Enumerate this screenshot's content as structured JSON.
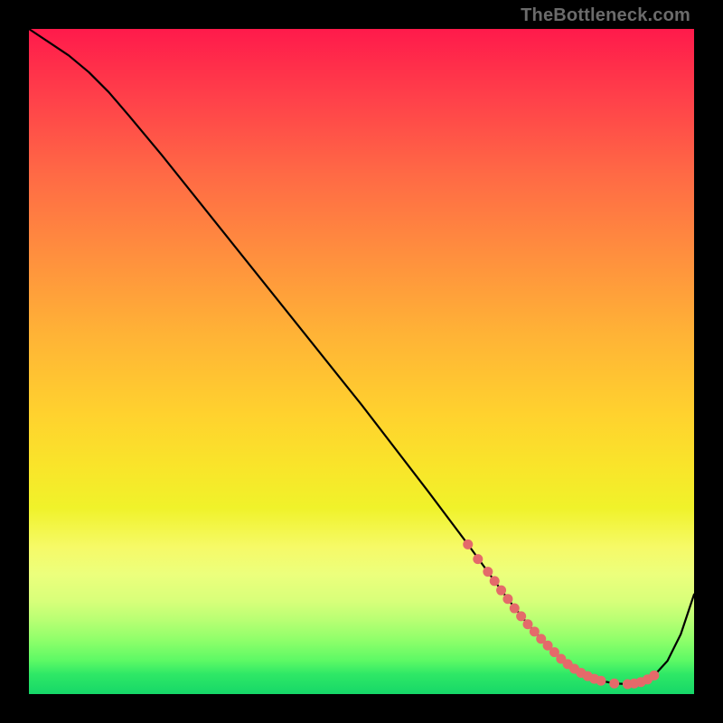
{
  "watermark": "TheBottleneck.com",
  "colors": {
    "dot": "#e46a6a",
    "line": "#000000",
    "frame_bg": "#000000"
  },
  "chart_data": {
    "type": "line",
    "title": "",
    "xlabel": "",
    "ylabel": "",
    "xlim": [
      0,
      100
    ],
    "ylim": [
      0,
      100
    ],
    "series": [
      {
        "name": "curve",
        "x": [
          0,
          3,
          6,
          9,
          12,
          15,
          20,
          30,
          40,
          50,
          60,
          66,
          70,
          72,
          75,
          78,
          80,
          82,
          84,
          86,
          88,
          90,
          92,
          94,
          96,
          98,
          100
        ],
        "y": [
          100,
          98,
          96,
          93.5,
          90.5,
          87,
          81,
          68.5,
          56,
          43.5,
          30.5,
          22.5,
          17,
          14.3,
          10.5,
          7.3,
          5.3,
          3.8,
          2.7,
          2.0,
          1.6,
          1.5,
          1.8,
          2.8,
          5.0,
          9.0,
          15.0
        ]
      }
    ],
    "scatter_points": {
      "name": "highlight-dots",
      "x": [
        66,
        67.5,
        69,
        70,
        71,
        72,
        73,
        74,
        75,
        76,
        77,
        78,
        79,
        80,
        81,
        82,
        83,
        84,
        85,
        86,
        88,
        90,
        91,
        92,
        93,
        94
      ],
      "y": [
        22.5,
        20.3,
        18.4,
        17.0,
        15.6,
        14.3,
        12.9,
        11.7,
        10.5,
        9.4,
        8.3,
        7.3,
        6.3,
        5.3,
        4.5,
        3.8,
        3.2,
        2.7,
        2.3,
        2.0,
        1.6,
        1.5,
        1.6,
        1.8,
        2.2,
        2.8
      ]
    }
  }
}
